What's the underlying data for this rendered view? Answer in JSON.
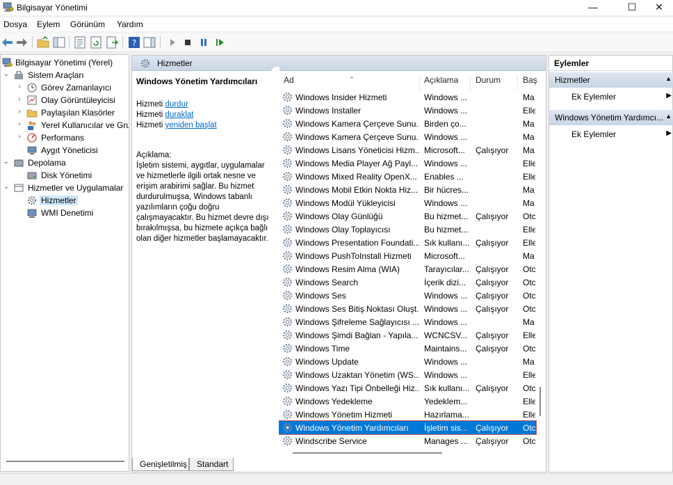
{
  "window": {
    "title": "Bilgisayar Yönetimi",
    "minimize_icon": "—",
    "maximize_icon": "☐",
    "close_icon": "✕"
  },
  "menu": [
    "Dosya",
    "Eylem",
    "Görünüm",
    "Yardım"
  ],
  "tree": {
    "root": "Bilgisayar Yönetimi (Yerel)",
    "items": [
      {
        "label": "Sistem Araçları",
        "level": 1,
        "arrow": "⌄"
      },
      {
        "label": "Görev Zamanlayıcı",
        "level": 2,
        "arrow": "›"
      },
      {
        "label": "Olay Görüntüleyicisi",
        "level": 2,
        "arrow": "›"
      },
      {
        "label": "Paylaşılan Klasörler",
        "level": 2,
        "arrow": "›"
      },
      {
        "label": "Yerel Kullanıcılar ve Gru",
        "level": 2,
        "arrow": "›"
      },
      {
        "label": "Performans",
        "level": 2,
        "arrow": "›"
      },
      {
        "label": "Aygıt Yöneticisi",
        "level": 2,
        "arrow": ""
      },
      {
        "label": "Depolama",
        "level": 1,
        "arrow": "⌄"
      },
      {
        "label": "Disk Yönetimi",
        "level": 2,
        "arrow": ""
      },
      {
        "label": "Hizmetler ve Uygulamalar",
        "level": 1,
        "arrow": "⌄"
      },
      {
        "label": "Hizmetler",
        "level": 2,
        "arrow": "",
        "selected": true
      },
      {
        "label": "WMI Denetimi",
        "level": 2,
        "arrow": ""
      }
    ]
  },
  "center": {
    "header": "Hizmetler",
    "selected_service": "Windows Yönetim Yardımcıları",
    "controls": {
      "prefix": "Hizmeti",
      "stop": "durdur",
      "pause": "duraklat",
      "restart": "yeniden başlat"
    },
    "description_label": "Açıklama:",
    "description": "İşletim sistemi, aygıtlar, uygulamalar ve hizmetlerle ilgili ortak nesne ve erişim arabirimi sağlar. Bu hizmet durdurulmuşsa, Windows tabanlı yazılımların çoğu doğru çalışmayacaktır. Bu hizmet devre dışı bırakılmışsa, bu hizmete açıkça bağlı olan diğer hizmetler başlamayacaktır."
  },
  "columns": {
    "name": "Ad",
    "description": "Açıklama",
    "status": "Durum",
    "startup": "Baş",
    "sort_indicator": "^"
  },
  "services": [
    {
      "name": "Windows Insider Hizmeti",
      "desc": "Windows ...",
      "status": "",
      "start": "Ma"
    },
    {
      "name": "Windows Installer",
      "desc": "Windows ...",
      "status": "",
      "start": "Elle"
    },
    {
      "name": "Windows Kamera Çerçeve Sunu...",
      "desc": "Birden ço...",
      "status": "",
      "start": "Ma"
    },
    {
      "name": "Windows Kamera Çerçeve Sunu...",
      "desc": "Windows ...",
      "status": "",
      "start": "Ma"
    },
    {
      "name": "Windows Lisans Yöneticisi Hizm...",
      "desc": "Microsoft...",
      "status": "Çalışıyor",
      "start": "Ma"
    },
    {
      "name": "Windows Media Player Ağ Payl...",
      "desc": "Windows ...",
      "status": "",
      "start": "Elle"
    },
    {
      "name": "Windows Mixed Reality OpenX...",
      "desc": "Enables ...",
      "status": "",
      "start": "Elle"
    },
    {
      "name": "Windows Mobil Etkin Nokta Hiz...",
      "desc": "Bir hücres...",
      "status": "",
      "start": "Ma"
    },
    {
      "name": "Windows Modül Yükleyicisi",
      "desc": "Windows ...",
      "status": "",
      "start": "Ma"
    },
    {
      "name": "Windows Olay Günlüğü",
      "desc": "Bu hizmet...",
      "status": "Çalışıyor",
      "start": "Otc"
    },
    {
      "name": "Windows Olay Toplayıcısı",
      "desc": "Bu hizmet...",
      "status": "",
      "start": "Elle"
    },
    {
      "name": "Windows Presentation Foundati...",
      "desc": "Sık kullanı...",
      "status": "Çalışıyor",
      "start": "Elle"
    },
    {
      "name": "Windows PushToInstall Hizmeti",
      "desc": "Microsoft...",
      "status": "",
      "start": "Ma"
    },
    {
      "name": "Windows Resim Alma (WIA)",
      "desc": "Tarayıcılar...",
      "status": "Çalışıyor",
      "start": "Otc"
    },
    {
      "name": "Windows Search",
      "desc": "İçerik dizi...",
      "status": "Çalışıyor",
      "start": "Otc"
    },
    {
      "name": "Windows Ses",
      "desc": "Windows ...",
      "status": "Çalışıyor",
      "start": "Otc"
    },
    {
      "name": "Windows Ses Bitiş Noktası Oluşt...",
      "desc": "Windows ...",
      "status": "Çalışıyor",
      "start": "Otc"
    },
    {
      "name": "Windows Şifreleme Sağlayıcısı ...",
      "desc": "Windows ...",
      "status": "",
      "start": "Ma"
    },
    {
      "name": "Windows Şimdi Bağlan - Yapıla...",
      "desc": "WCNCSV...",
      "status": "Çalışıyor",
      "start": "Elle"
    },
    {
      "name": "Windows Time",
      "desc": "Maintains...",
      "status": "Çalışıyor",
      "start": "Otc"
    },
    {
      "name": "Windows Update",
      "desc": "Windows ...",
      "status": "",
      "start": "Ma"
    },
    {
      "name": "Windows Uzaktan Yönetim (WS...",
      "desc": "Windows ...",
      "status": "",
      "start": "Elle"
    },
    {
      "name": "Windows Yazı Tipi Önbelleği Hiz...",
      "desc": "Sık kullanı...",
      "status": "Çalışıyor",
      "start": "Otc"
    },
    {
      "name": "Windows Yedekleme",
      "desc": "Yedeklem...",
      "status": "",
      "start": "Elle"
    },
    {
      "name": "Windows Yönetim Hizmeti",
      "desc": "Hazırlama...",
      "status": "",
      "start": "Elle"
    },
    {
      "name": "Windows Yönetim Yardımcıları",
      "desc": "İşletim sis...",
      "status": "Çalışıyor",
      "start": "Otc",
      "selected": true
    },
    {
      "name": "Windscribe Service",
      "desc": "Manages ...",
      "status": "Çalışıyor",
      "start": "Otc"
    }
  ],
  "tabs": [
    "Genişletilmiş",
    "Standart"
  ],
  "actions": {
    "header": "Eylemler",
    "sections": [
      {
        "title": "Hizmetler",
        "item": "Ek Eylemler"
      },
      {
        "title": "Windows Yönetim Yardımcı...",
        "item": "Ek Eylemler"
      }
    ],
    "caret_up": "▲",
    "caret_right": "▶"
  },
  "colors": {
    "selection": "#0078d7",
    "selection_outline": "#d9534f",
    "link": "#0066cc",
    "header_gradient_top": "#dfe7f1",
    "header_gradient_bottom": "#c9d5e4"
  }
}
